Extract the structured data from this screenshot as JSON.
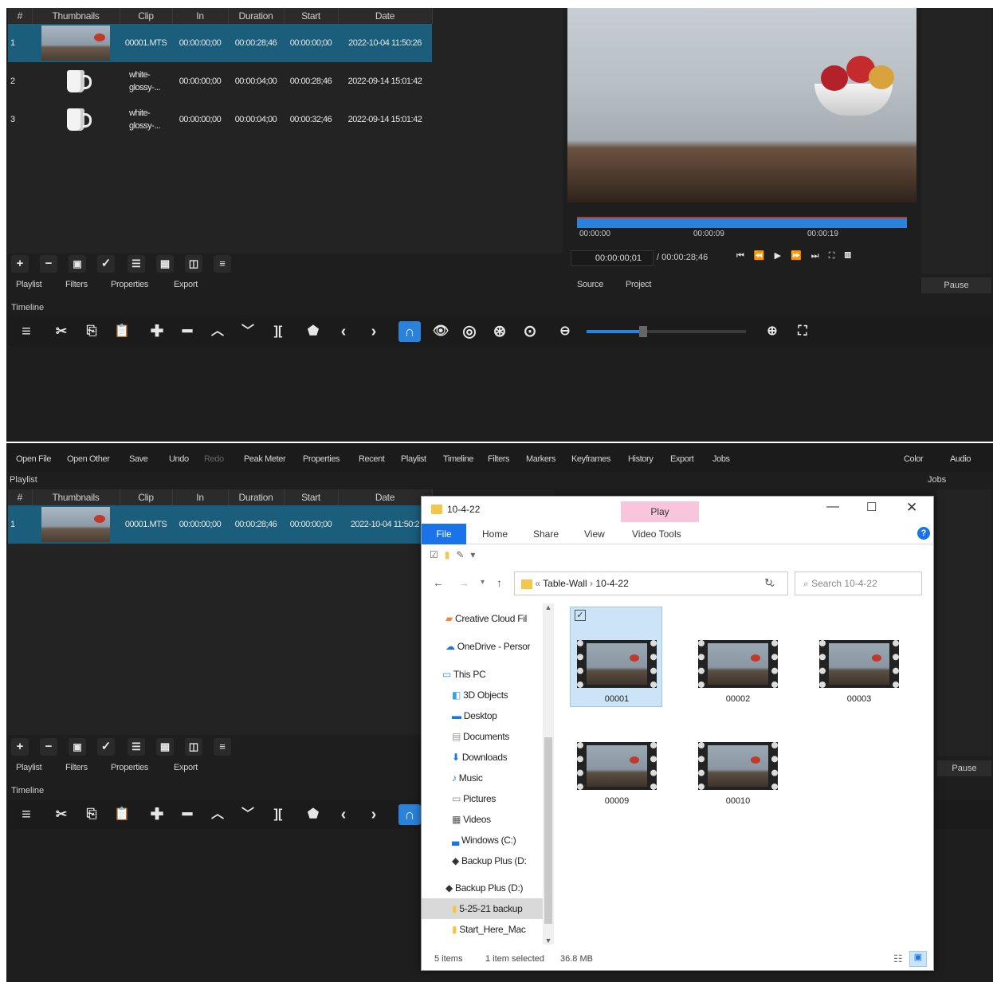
{
  "top": {
    "playlist_headers": [
      "#",
      "Thumbnails",
      "Clip",
      "In",
      "Duration",
      "Start",
      "Date"
    ],
    "rows": [
      {
        "idx": "1",
        "clip": "00001.MTS",
        "in": "00:00:00;00",
        "duration": "00:00:28;46",
        "start": "00:00:00;00",
        "date": "2022-10-04 11:50:26",
        "thumb": "video"
      },
      {
        "idx": "2",
        "clip": "white-glossy-...",
        "in": "00:00:00;00",
        "duration": "00:00:04;00",
        "start": "00:00:28;46",
        "date": "2022-09-14 15:01:42",
        "thumb": "mug"
      },
      {
        "idx": "3",
        "clip": "white-glossy-...",
        "in": "00:00:00;00",
        "duration": "00:00:04;00",
        "start": "00:00:32;46",
        "date": "2022-09-14 15:01:42",
        "thumb": "mug"
      }
    ],
    "tabs": [
      "Playlist",
      "Filters",
      "Properties",
      "Export"
    ],
    "player": {
      "ruler": [
        "00:00:00",
        "00:00:09",
        "00:00:19"
      ],
      "position": "00:00:00;01",
      "total": "/ 00:00:28;46",
      "tabs": [
        "Source",
        "Project"
      ],
      "pause": "Pause"
    },
    "timeline_label": "Timeline"
  },
  "bottom": {
    "menu": [
      "Open File",
      "Open Other",
      "Save",
      "Undo",
      "Redo",
      "Peak Meter",
      "Properties",
      "Recent",
      "Playlist",
      "Timeline",
      "Filters",
      "Markers",
      "Keyframes",
      "History",
      "Export",
      "Jobs",
      "Color",
      "Audio"
    ],
    "playlist_label": "Playlist",
    "jobs_label": "Jobs",
    "playlist_headers": [
      "#",
      "Thumbnails",
      "Clip",
      "In",
      "Duration",
      "Start",
      "Date"
    ],
    "rows": [
      {
        "idx": "1",
        "clip": "00001.MTS",
        "in": "00:00:00;00",
        "duration": "00:00:28;46",
        "start": "00:00:00;00",
        "date": "2022-10-04 11:50:2"
      }
    ],
    "tabs": [
      "Playlist",
      "Filters",
      "Properties",
      "Export"
    ],
    "pause": "Pause",
    "timeline_label": "Timeline"
  },
  "explorer": {
    "title": "10-4-22",
    "contextual_tab": "Play",
    "ribbon_tabs": [
      "File",
      "Home",
      "Share",
      "View",
      "Video Tools"
    ],
    "path": [
      "Table-Wall",
      "10-4-22"
    ],
    "search_placeholder": "Search 10-4-22",
    "nav": [
      "Creative Cloud Fil",
      "OneDrive - Persor",
      "This PC",
      "3D Objects",
      "Desktop",
      "Documents",
      "Downloads",
      "Music",
      "Pictures",
      "Videos",
      "Windows (C:)",
      "Backup Plus (D:",
      "Backup Plus (D:)",
      "5-25-21 backup",
      "Start_Here_Mac"
    ],
    "files": [
      "00001",
      "00002",
      "00003",
      "00009",
      "00010"
    ],
    "status": {
      "count": "5 items",
      "selected": "1 item selected",
      "size": "36.8 MB"
    }
  },
  "colors": {
    "bg": "#1e1e1e",
    "panel": "#232323",
    "selection": "#1a5e7c",
    "accent": "#2a82da",
    "explorer_file_tab": "#1a73e8",
    "play_tab": "#f7c5dc"
  }
}
